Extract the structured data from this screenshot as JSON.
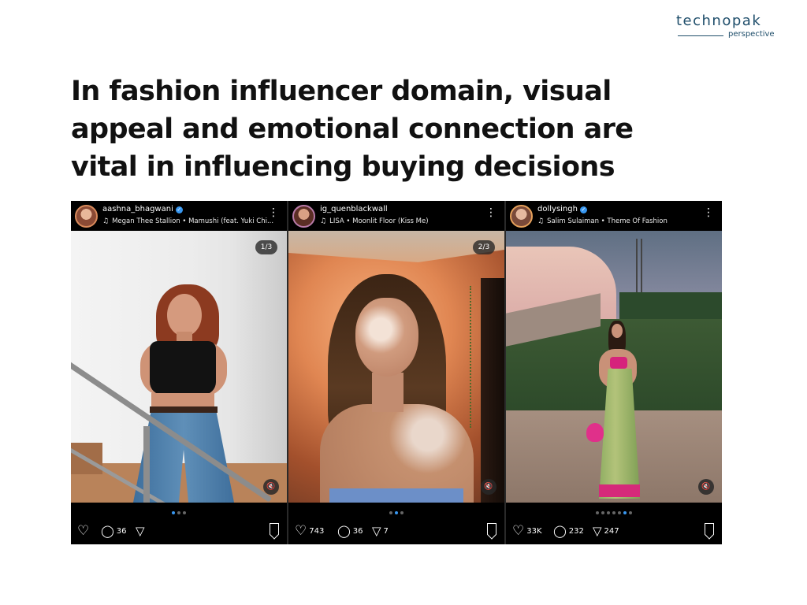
{
  "brand": {
    "name": "technopak",
    "tagline": "perspective"
  },
  "headline": {
    "line1": "In fashion influencer domain, visual",
    "line2": "appeal and emotional connection are",
    "line3": "vital in influencing buying decisions"
  },
  "posts": [
    {
      "username": "aashna_bhagwani",
      "verified": true,
      "audio": "Megan Thee Stallion • Mamushi (feat. Yuki Chi...",
      "counter": "1/3",
      "likes": "",
      "comments": "36",
      "shares": ""
    },
    {
      "username": "ig_quenblackwall",
      "verified": false,
      "audio": "LISA • Moonlit Floor (Kiss Me)",
      "counter": "2/3",
      "likes": "743",
      "comments": "36",
      "shares": "7"
    },
    {
      "username": "dollysingh",
      "verified": true,
      "audio": "Salim Sulaiman • Theme Of Fashion",
      "counter": "",
      "likes": "33K",
      "comments": "232",
      "shares": "247"
    }
  ],
  "icons": {
    "more": "⋮",
    "music": "♫",
    "heart": "♡",
    "comment": "◯",
    "share": "▽",
    "mute": "🔇",
    "verified": "✓"
  },
  "colors": {
    "brand": "#1f4e6b",
    "headline": "#111111",
    "instagram_blue": "#3897f0"
  }
}
